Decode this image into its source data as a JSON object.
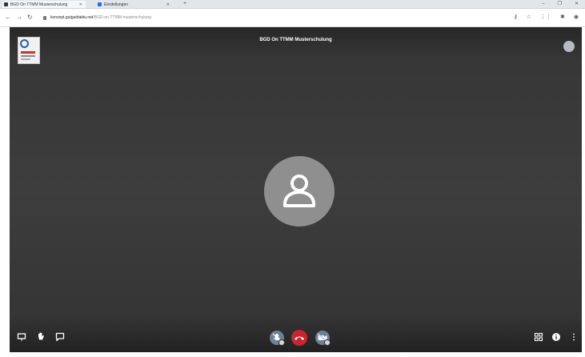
{
  "browser": {
    "tabs": [
      {
        "label": "BGD On TTMM Musterschulung",
        "active": true,
        "favicon_color": "#333333"
      },
      {
        "label": "Einstellungen",
        "active": false,
        "favicon_color": "#1a73e8"
      }
    ],
    "new_tab_glyph": "+",
    "url_host": "konzept.gutgutdaktu.net",
    "url_path": "/BGD-on-TTMM-musterschulung"
  },
  "meeting": {
    "title": "BGD On TTMM Musterschulung",
    "colors": {
      "background": "#3a3a3a",
      "hangup": "#c9252c",
      "media_button": "#6e7f99",
      "avatar": "#8f8f8f"
    },
    "toolbar_left": [
      {
        "name": "screen-share-icon"
      },
      {
        "name": "raise-hand-icon"
      },
      {
        "name": "chat-icon"
      }
    ],
    "toolbar_center": [
      {
        "name": "microphone-icon"
      },
      {
        "name": "hangup-icon"
      },
      {
        "name": "camera-icon"
      }
    ],
    "toolbar_right": [
      {
        "name": "tile-view-icon"
      },
      {
        "name": "info-icon"
      },
      {
        "name": "more-options-icon"
      }
    ]
  }
}
